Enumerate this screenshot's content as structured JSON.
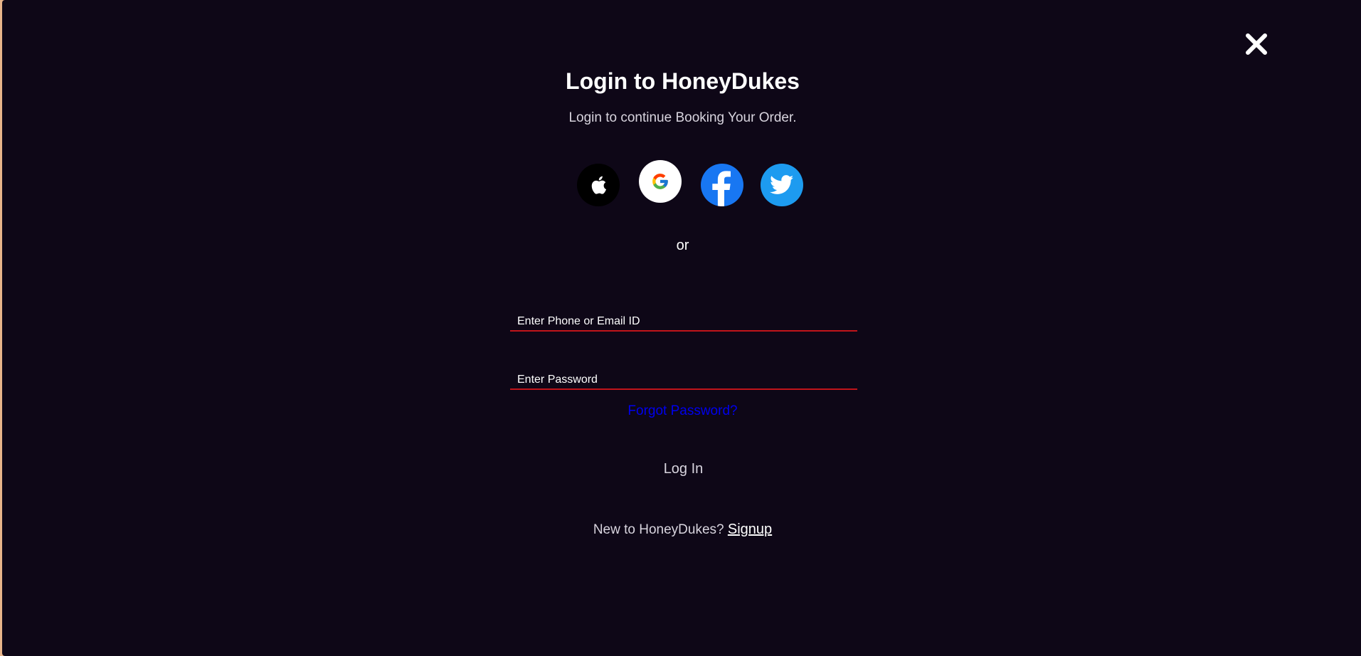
{
  "header": {
    "title": "Login to HoneyDukes",
    "subtitle": "Login to continue Booking Your Order."
  },
  "social_logins": [
    {
      "icon": "apple-icon",
      "color": "#000000"
    },
    {
      "icon": "google-icon",
      "color": "#ffffff"
    },
    {
      "icon": "facebook-icon",
      "color": "#1877f2"
    },
    {
      "icon": "twitter-icon",
      "color": "#1d9bf0"
    }
  ],
  "divider_text": "or",
  "form": {
    "email_placeholder": "Enter Phone or Email ID",
    "email_value": "",
    "password_placeholder": "Enter Password",
    "password_value": "",
    "forgot_label": "Forgot Password?",
    "login_label": "Log In"
  },
  "footer": {
    "prompt": "New to HoneyDukes? ",
    "signup_label": "Signup"
  },
  "colors": {
    "background": "#0e0717",
    "field_underline": "#c0141a",
    "link": "#0000ee",
    "page_edge": "#e8b48a"
  }
}
